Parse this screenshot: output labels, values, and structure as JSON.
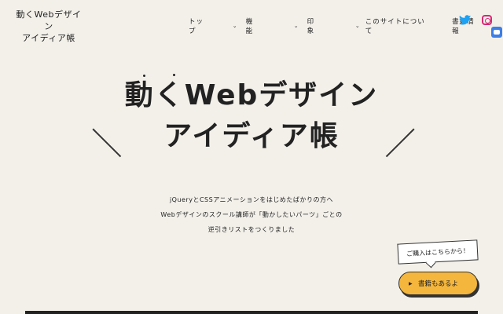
{
  "logo": {
    "line1": "動くWebデザイン",
    "line2": "アイディア帳"
  },
  "nav": {
    "items": [
      {
        "label": "トップ",
        "has_chevron": false
      },
      {
        "label": "機 能",
        "has_chevron": true
      },
      {
        "label": "印 象",
        "has_chevron": true
      },
      {
        "label": "このサイトについて",
        "has_chevron": true
      },
      {
        "label": "書籍情報",
        "has_chevron": false
      }
    ],
    "chevron_glyph": "⌄"
  },
  "social": {
    "twitter_icon": "twitter-icon",
    "instagram_icon": "instagram-icon",
    "colors": {
      "twitter": "#1da1f2",
      "instagram": "#d62976"
    }
  },
  "chat_widget_icon": "chat-icon",
  "hero": {
    "title_line1": "動くWebデザイン",
    "title_line2": "アイディア帳"
  },
  "lead": {
    "line1": "jQueryとCSSアニメーションをはじめたばかりの方へ",
    "line2": "Webデザインのスクール講師が「動かしたいパーツ」ごとの",
    "line3": "逆引きリストをつくりました"
  },
  "purchase": {
    "note": "ご購入はこちらから！",
    "button_label": "書籍もあるよ",
    "button_color": "#f4b63c"
  },
  "background_color": "#f3f0ea"
}
